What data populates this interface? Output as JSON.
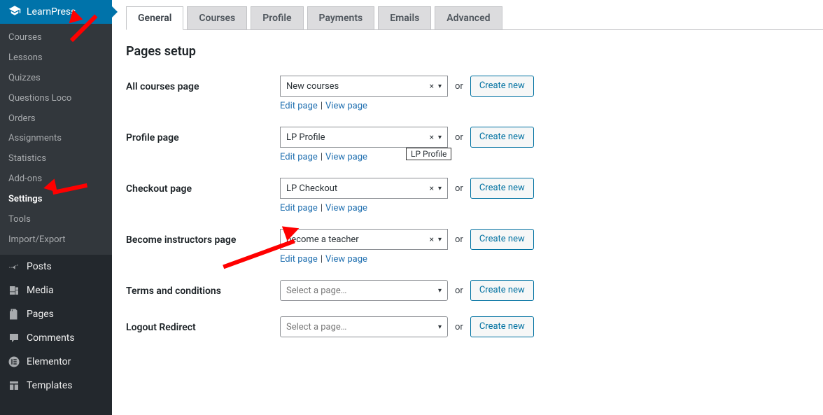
{
  "sidebar": {
    "pluginTitle": "LearnPress",
    "submenu": [
      {
        "label": "Courses"
      },
      {
        "label": "Lessons"
      },
      {
        "label": "Quizzes"
      },
      {
        "label": "Questions Loco"
      },
      {
        "label": "Orders"
      },
      {
        "label": "Assignments"
      },
      {
        "label": "Statistics"
      },
      {
        "label": "Add-ons"
      },
      {
        "label": "Settings",
        "active": true
      },
      {
        "label": "Tools"
      },
      {
        "label": "Import/Export"
      }
    ],
    "mainMenu": [
      {
        "label": "Posts",
        "icon": "pin"
      },
      {
        "label": "Media",
        "icon": "media"
      },
      {
        "label": "Pages",
        "icon": "pages"
      },
      {
        "label": "Comments",
        "icon": "comments"
      },
      {
        "label": "Elementor",
        "icon": "elementor"
      },
      {
        "label": "Templates",
        "icon": "templates"
      }
    ]
  },
  "tabs": [
    {
      "label": "General",
      "active": true
    },
    {
      "label": "Courses"
    },
    {
      "label": "Profile"
    },
    {
      "label": "Payments"
    },
    {
      "label": "Emails"
    },
    {
      "label": "Advanced"
    }
  ],
  "panel": {
    "heading": "Pages setup",
    "rows": [
      {
        "label": "All courses page",
        "value": "New courses",
        "hasClear": true,
        "hasLinks": true
      },
      {
        "label": "Profile page",
        "value": "LP Profile",
        "hasClear": true,
        "hasLinks": true,
        "tooltip": "LP Profile"
      },
      {
        "label": "Checkout page",
        "value": "LP Checkout",
        "hasClear": true,
        "hasLinks": true
      },
      {
        "label": "Become instructors page",
        "value": "become a teacher",
        "hasClear": true,
        "hasLinks": true
      },
      {
        "label": "Terms and conditions",
        "value": "Select a page…",
        "placeholder": true
      },
      {
        "label": "Logout Redirect",
        "value": "Select a page…",
        "placeholder": true
      }
    ],
    "orText": "or",
    "createNew": "Create new",
    "editPage": "Edit page",
    "viewPage": "View page"
  }
}
